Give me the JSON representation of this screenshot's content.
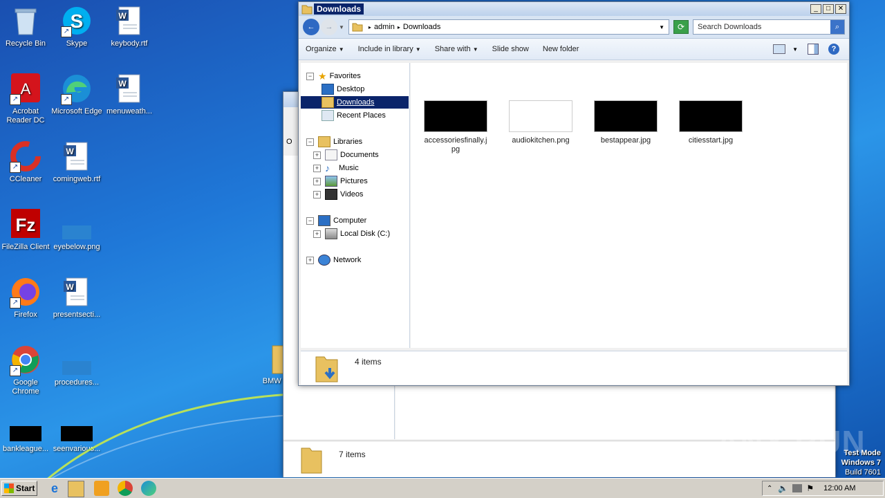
{
  "desktop": {
    "icons": [
      {
        "label": "Recycle Bin",
        "icon": "recycle-bin-icon"
      },
      {
        "label": "Skype",
        "icon": "skype-icon"
      },
      {
        "label": "keybody.rtf",
        "icon": "word-doc-icon"
      },
      {
        "label": "Acrobat Reader DC",
        "icon": "acrobat-icon"
      },
      {
        "label": "Microsoft Edge",
        "icon": "edge-icon"
      },
      {
        "label": "menuweath...",
        "icon": "word-doc-icon"
      },
      {
        "label": "CCleaner",
        "icon": "ccleaner-icon"
      },
      {
        "label": "comingweb.rtf",
        "icon": "word-doc-icon"
      },
      {
        "label": "FileZilla Client",
        "icon": "filezilla-icon"
      },
      {
        "label": "eyebelow.png",
        "icon": "image-icon"
      },
      {
        "label": "Firefox",
        "icon": "firefox-icon"
      },
      {
        "label": "presentsecti...",
        "icon": "word-doc-icon"
      },
      {
        "label": "Google Chrome",
        "icon": "chrome-icon"
      },
      {
        "label": "procedures...",
        "icon": "image-icon"
      },
      {
        "label": "bankleague...",
        "icon": "image-icon"
      },
      {
        "label": "seenvarious...",
        "icon": "image-icon"
      },
      {
        "label": "BMW T",
        "icon": "folder-icon"
      }
    ]
  },
  "back_window": {
    "status": "7 items",
    "toolbar_fragment": "O"
  },
  "explorer": {
    "title": "Downloads",
    "breadcrumb": [
      "admin",
      "Downloads"
    ],
    "search_placeholder": "Search Downloads",
    "toolbar": [
      "Organize",
      "Include in library",
      "Share with",
      "Slide show",
      "New folder"
    ],
    "nav": {
      "favorites": "Favorites",
      "fav_items": [
        "Desktop",
        "Downloads",
        "Recent Places"
      ],
      "libraries": "Libraries",
      "lib_items": [
        "Documents",
        "Music",
        "Pictures",
        "Videos"
      ],
      "computer": "Computer",
      "comp_items": [
        "Local Disk (C:)"
      ],
      "network": "Network"
    },
    "files": [
      {
        "name": "accessoriesfinally.jpg",
        "thumb": "#000000"
      },
      {
        "name": "audiokitchen.png",
        "thumb": "#ffffff"
      },
      {
        "name": "bestappear.jpg",
        "thumb": "#000000"
      },
      {
        "name": "citiesstart.jpg",
        "thumb": "#000000"
      }
    ],
    "status": "4 items"
  },
  "taskbar": {
    "start": "Start",
    "clock": "12:00 AM"
  },
  "watermark": {
    "line1": "Test Mode",
    "line2": "Windows 7",
    "line3": "Build 7601",
    "brand": "ANY RUN"
  }
}
